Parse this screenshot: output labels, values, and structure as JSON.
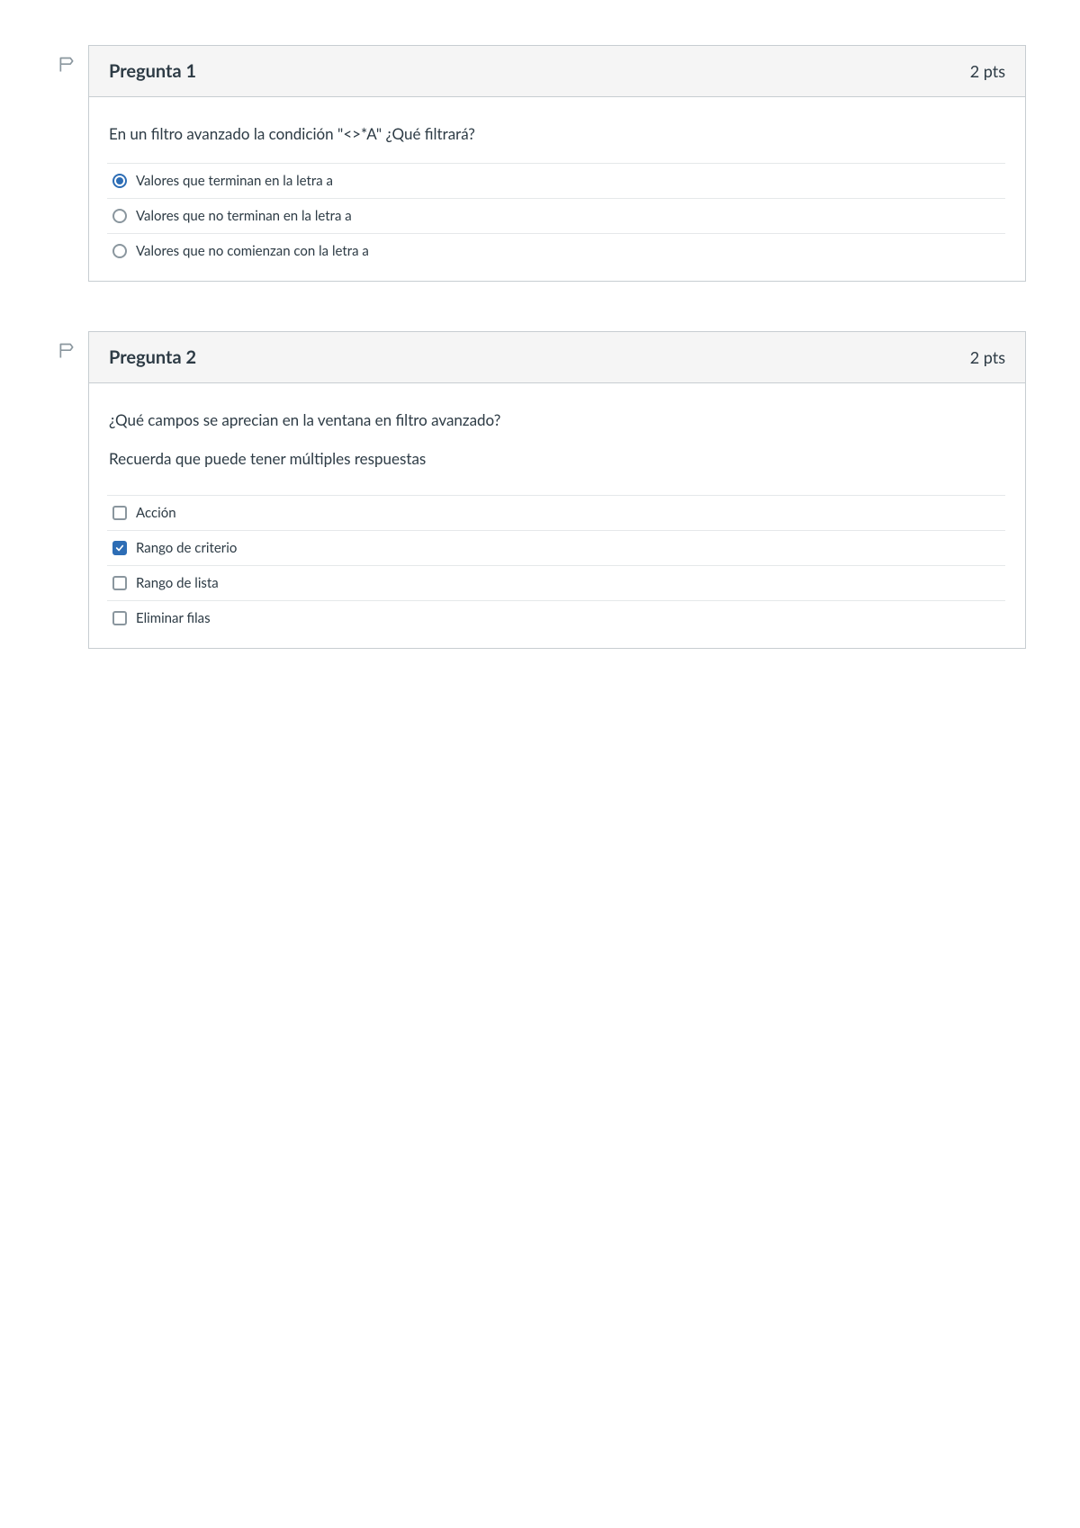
{
  "questions": [
    {
      "title": "Pregunta 1",
      "points": "2 pts",
      "prompt": "En un filtro avanzado la condición \"<>*A\" ¿Qué filtrará?",
      "subprompt": "",
      "type": "radio",
      "answers": [
        {
          "label": "Valores que terminan en la letra a",
          "selected": true
        },
        {
          "label": "Valores que no terminan en la letra a",
          "selected": false
        },
        {
          "label": "Valores que no comienzan con la letra a",
          "selected": false
        }
      ]
    },
    {
      "title": "Pregunta 2",
      "points": "2 pts",
      "prompt": "¿Qué campos se aprecian en la ventana en filtro avanzado?",
      "subprompt": "Recuerda que puede tener múltiples respuestas",
      "type": "checkbox",
      "answers": [
        {
          "label": "Acción",
          "selected": false
        },
        {
          "label": "Rango de criterio",
          "selected": true
        },
        {
          "label": "Rango de lista",
          "selected": false
        },
        {
          "label": "Eliminar filas",
          "selected": false
        }
      ]
    }
  ]
}
